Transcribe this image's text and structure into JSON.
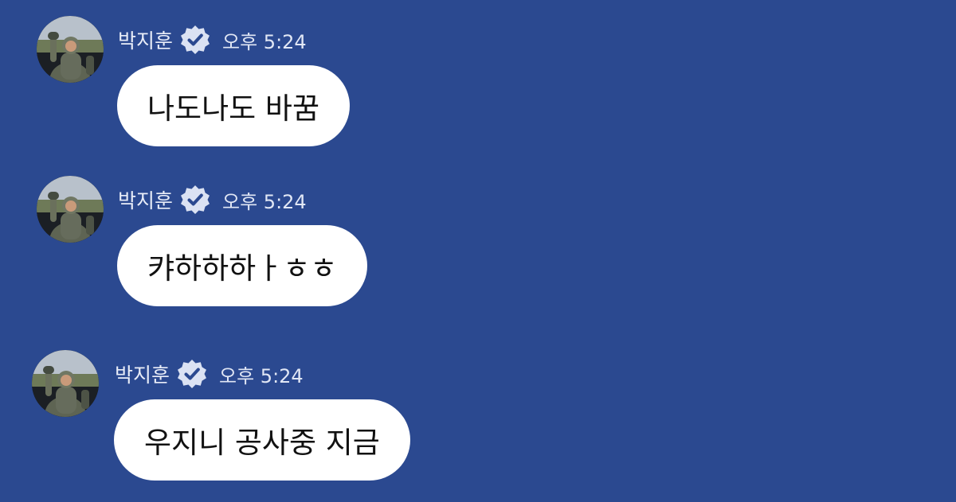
{
  "colors": {
    "background": "#2b4990",
    "bubble": "#ffffff",
    "meta_text": "#e6ebf7",
    "verified_badge": "#dbe2f3"
  },
  "messages": [
    {
      "sender": "박지훈",
      "time": "오후 5:24",
      "text": "나도나도 바꿈"
    },
    {
      "sender": "박지훈",
      "time": "오후 5:24",
      "text": "캬하하하ㅏㅎㅎ"
    },
    {
      "sender": "박지훈",
      "time": "오후 5:24",
      "text": "우지니 공사중 지금"
    }
  ]
}
